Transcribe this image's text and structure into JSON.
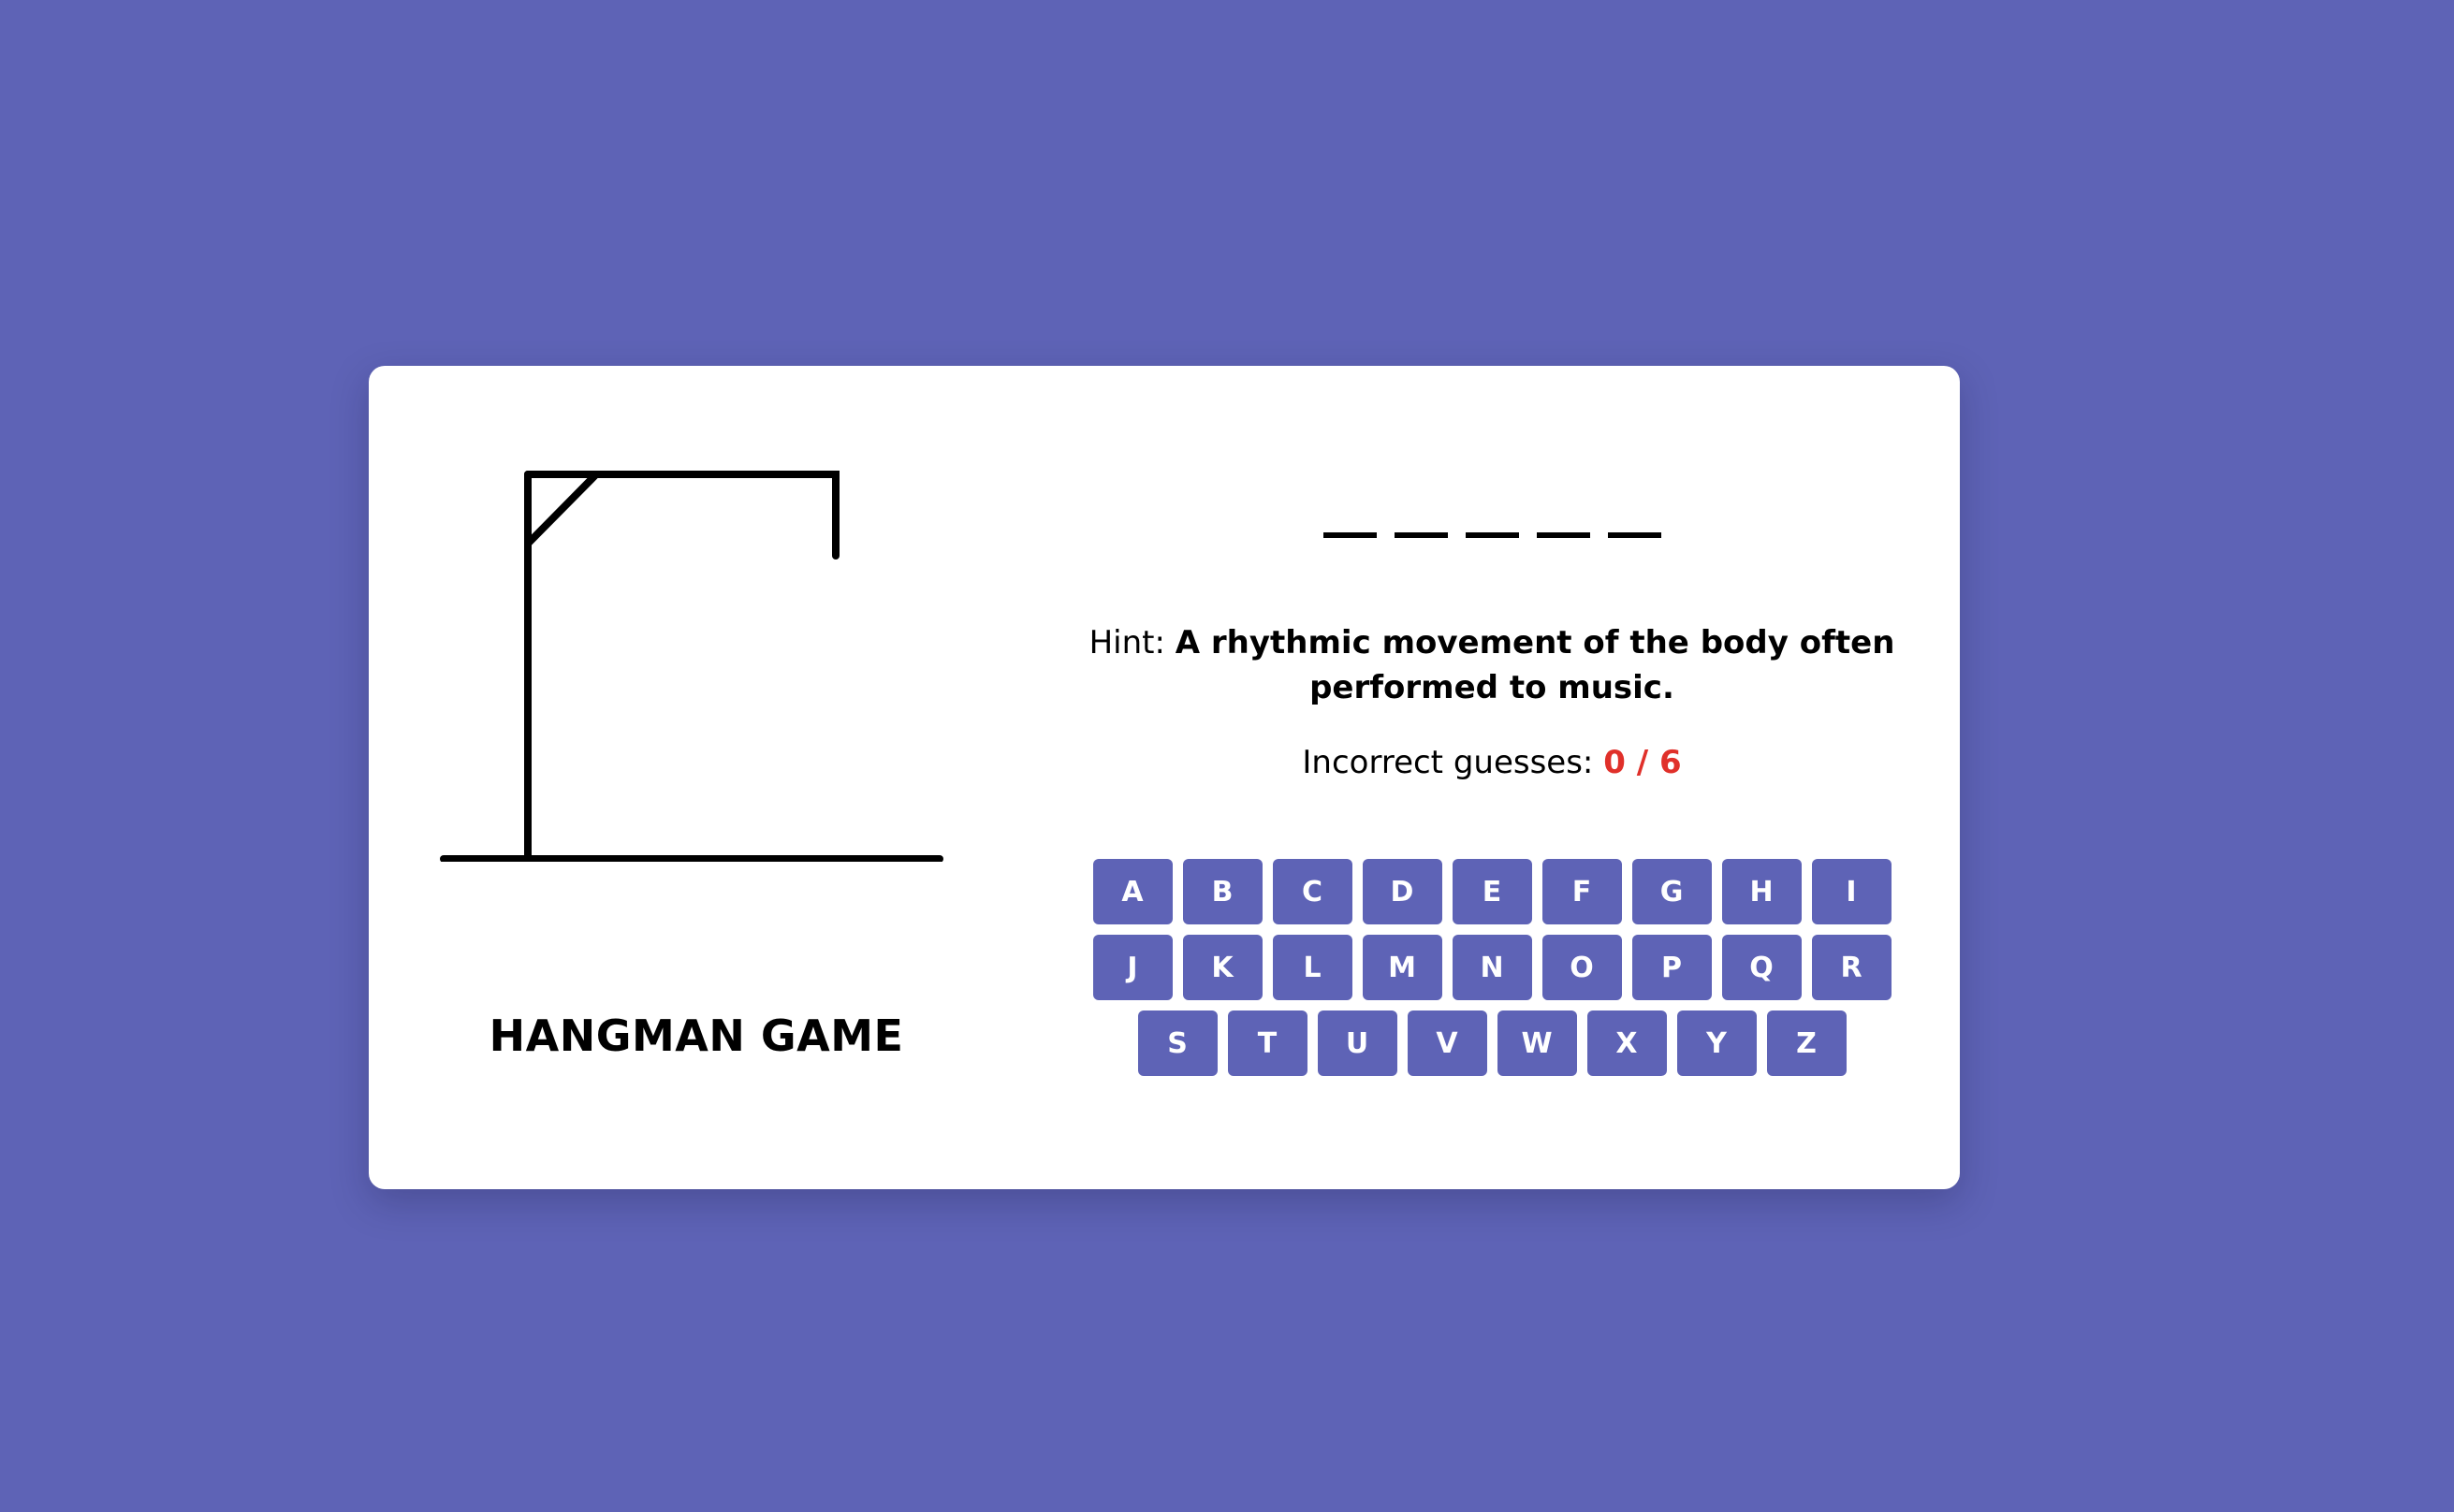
{
  "game": {
    "title": "HANGMAN GAME",
    "word_blank_count": 5,
    "hint_label": "Hint:",
    "hint_text": "A rhythmic movement of the body often performed to music.",
    "incorrect_label": "Incorrect guesses:",
    "incorrect_count": "0 / 6"
  },
  "keyboard": {
    "rows": [
      [
        "A",
        "B",
        "C",
        "D",
        "E",
        "F",
        "G",
        "H",
        "I"
      ],
      [
        "J",
        "K",
        "L",
        "M",
        "N",
        "O",
        "P",
        "Q",
        "R"
      ],
      [
        "S",
        "T",
        "U",
        "V",
        "W",
        "X",
        "Y",
        "Z"
      ]
    ]
  },
  "colors": {
    "background": "#5e63b6",
    "card": "#ffffff",
    "key": "#5e63b6",
    "key_text": "#ffffff",
    "incorrect_count": "#e0302a"
  }
}
